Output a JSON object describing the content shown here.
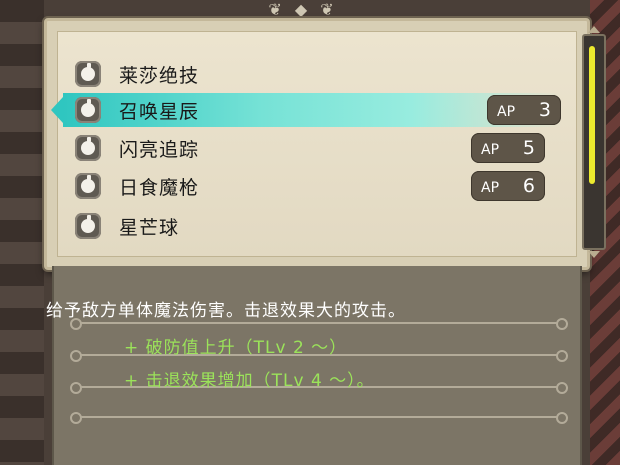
{
  "skills": [
    {
      "name": "莱莎绝技",
      "ap_label": "",
      "ap": ""
    },
    {
      "name": "召唤星辰",
      "ap_label": "AP",
      "ap": "3"
    },
    {
      "name": "闪亮追踪",
      "ap_label": "AP",
      "ap": "5"
    },
    {
      "name": "日食魔枪",
      "ap_label": "AP",
      "ap": "6"
    },
    {
      "name": "星芒球",
      "ap_label": "",
      "ap": ""
    }
  ],
  "selected_index": 1,
  "description": {
    "main": "给予敌方单体魔法伤害。击退效果大的攻击。",
    "effects": [
      "+ 破防值上升（TLv 2 ～）",
      "+ 击退效果增加（TLv 4 ～）。"
    ]
  },
  "scroll": {
    "position_fraction": 0.0,
    "visible_fraction": 0.66
  },
  "icons": {
    "skill_icon": "bomb-icon"
  },
  "colors": {
    "highlight": "#2fc6c0",
    "effect_text": "#9be35a",
    "scroll_thumb": "#ecea2e"
  }
}
